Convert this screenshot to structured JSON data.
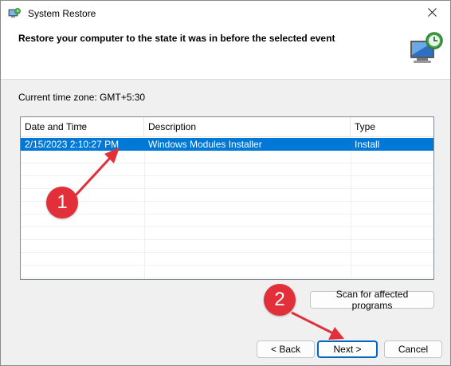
{
  "window": {
    "title": "System Restore",
    "app_icon": "system-restore-icon",
    "close_icon": "close-icon"
  },
  "header": {
    "title": "Restore your computer to the state it was in before the selected event",
    "icon": "system-restore-monitor-icon"
  },
  "timezone": {
    "label": "Current time zone: GMT+5:30"
  },
  "table": {
    "columns": [
      "Date and Time",
      "Description",
      "Type"
    ],
    "sorted_column": "Date and Time",
    "rows": [
      {
        "date": "2/15/2023 2:10:27 PM",
        "description": "Windows Modules Installer",
        "type": "Install",
        "selected": true
      }
    ]
  },
  "buttons": {
    "scan": "Scan for affected programs",
    "back": "< Back",
    "next": "Next >",
    "cancel": "Cancel"
  },
  "annotations": {
    "marker1": "1",
    "marker2": "2"
  },
  "colors": {
    "selection": "#0078d7",
    "marker": "#e2303a",
    "primary_border": "#0067c0"
  }
}
